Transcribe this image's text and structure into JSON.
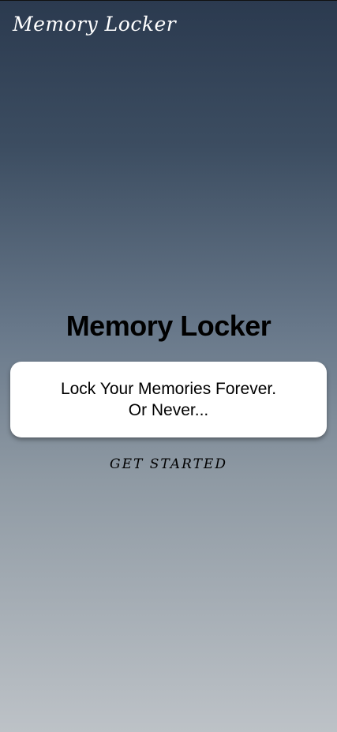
{
  "app_bar": {
    "title": "Memory Locker"
  },
  "hero": {
    "title": "Memory Locker"
  },
  "tagline_card": {
    "line1": "Lock Your Memories Forever.",
    "line2": "Or Never..."
  },
  "actions": {
    "get_started_label": "GET STARTED"
  },
  "colors": {
    "gradient_top": "#2b3a4f",
    "gradient_bottom": "#bdc2c7",
    "card_background": "#ffffff",
    "title_text": "#000000",
    "app_bar_text": "#ffffff"
  }
}
